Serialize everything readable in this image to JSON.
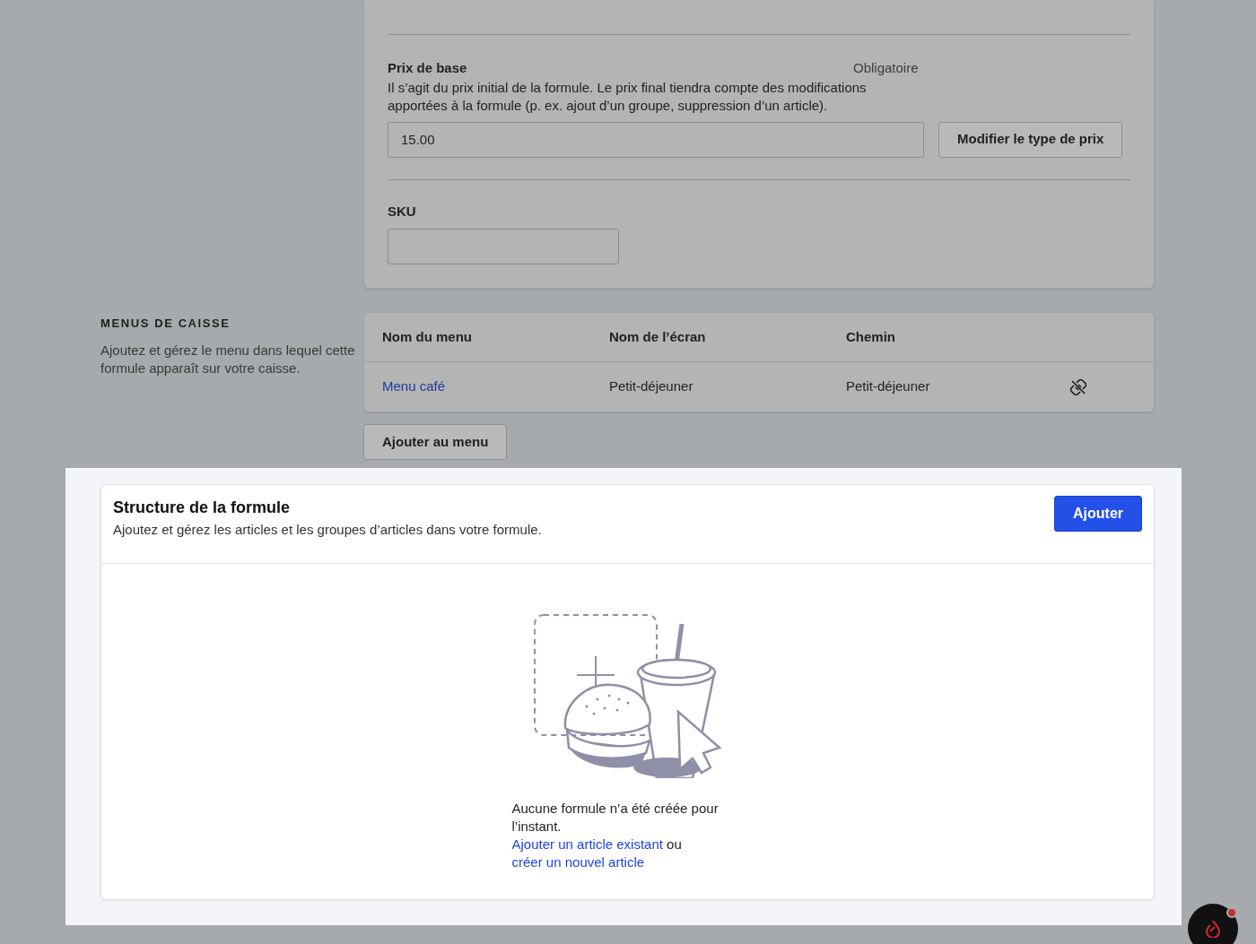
{
  "base_price": {
    "label": "Prix de base",
    "required": "Obligatoire",
    "description": "Il s’agit du prix initial de la formule. Le prix final tiendra compte des modifications apportées à la formule (p. ex. ajout d’un groupe, suppression d’un article).",
    "value": "15.00",
    "button": "Modifier le type de prix"
  },
  "sku": {
    "label": "SKU"
  },
  "pos_menus": {
    "title": "MENUS DE CAISSE",
    "description": "Ajoutez et gérez le menu dans lequel cette formule apparaît sur votre caisse.",
    "columns": [
      "Nom du menu",
      "Nom de l’écran",
      "Chemin"
    ],
    "rows": [
      {
        "menu": "Menu café",
        "screen": "Petit-déjeuner",
        "path": "Petit-déjeuner"
      }
    ],
    "add_button": "Ajouter au menu"
  },
  "structure": {
    "title": "Structure de la formule",
    "subtitle": "Ajoutez et gérez les articles et les groupes d’articles dans votre formule.",
    "add_button": "Ajouter",
    "empty_message": "Aucune formule n’a été créée pour l’instant.",
    "link_existing": "Ajouter un article existant",
    "joiner": "ou",
    "link_new": "créer un nouvel article"
  }
}
